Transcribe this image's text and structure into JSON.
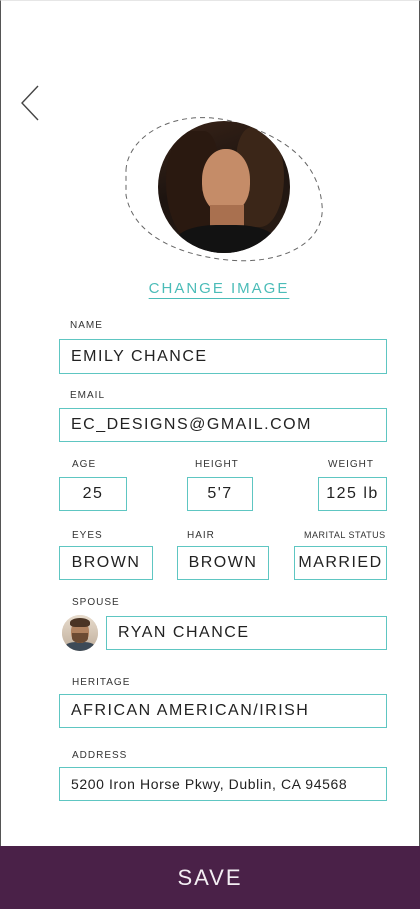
{
  "profile": {
    "change_image_label": "CHANGE IMAGE"
  },
  "form": {
    "name": {
      "label": "NAME",
      "value": "EMILY CHANCE"
    },
    "email": {
      "label": "EMAIL",
      "value": "EC_DESIGNS@GMAIL.COM"
    },
    "age": {
      "label": "AGE",
      "value": "25"
    },
    "height": {
      "label": "HEIGHT",
      "value": "5'7"
    },
    "weight": {
      "label": "WEIGHT",
      "value": "125 lb"
    },
    "eyes": {
      "label": "EYES",
      "value": "BROWN"
    },
    "hair": {
      "label": "HAIR",
      "value": "BROWN"
    },
    "marital_status": {
      "label": "MARITAL STATUS",
      "value": "MARRIED"
    },
    "spouse": {
      "label": "SPOUSE",
      "value": "RYAN CHANCE"
    },
    "heritage": {
      "label": "HERITAGE",
      "value": "AFRICAN AMERICAN/IRISH"
    },
    "address": {
      "label": "ADDRESS",
      "value": "5200 Iron Horse Pkwy, Dublin, CA 94568"
    }
  },
  "footer": {
    "save_label": "SAVE"
  },
  "colors": {
    "accent": "#5ec6c2",
    "link": "#4bbcb8",
    "save_bar": "#4a2148"
  },
  "icons": {
    "back": "chevron-left-icon"
  }
}
